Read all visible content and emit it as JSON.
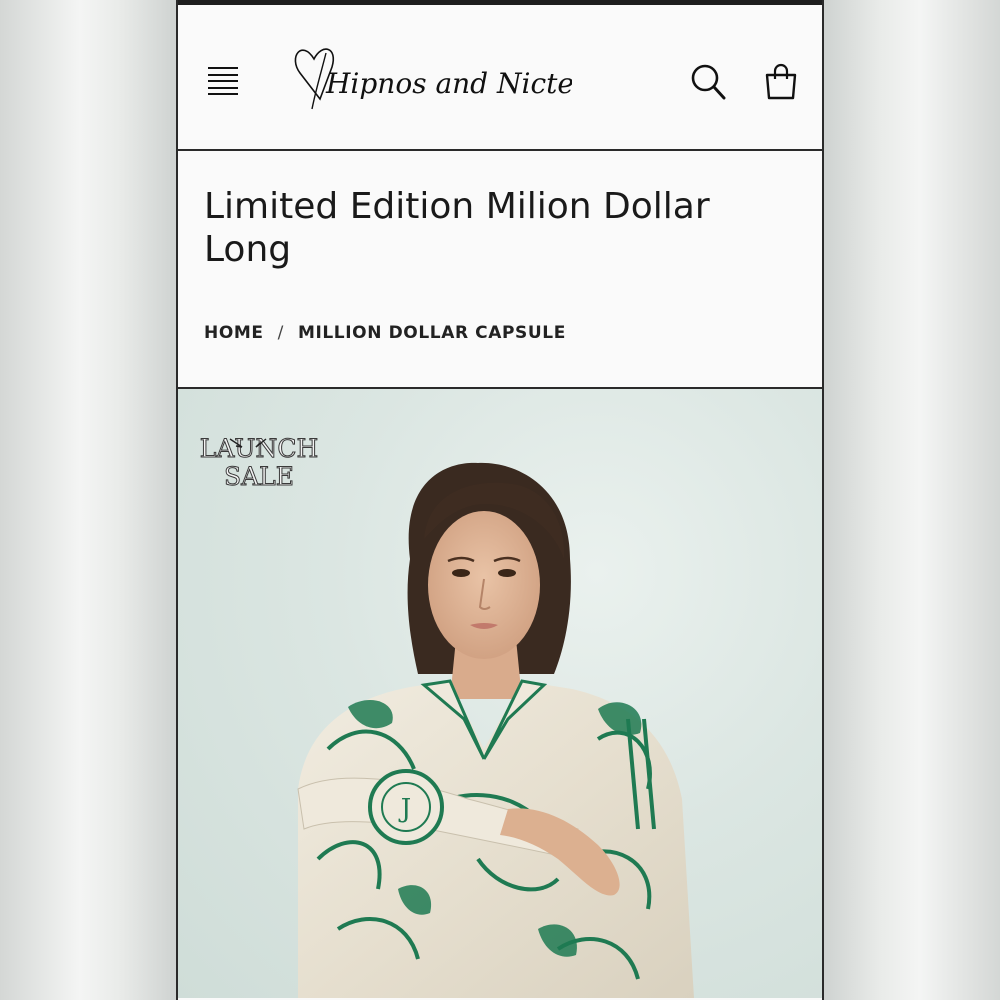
{
  "header": {
    "logo_text": "Hipnos and Nicte",
    "icons": {
      "menu": "hamburger-menu-icon",
      "search": "search-icon",
      "cart": "shopping-bag-icon"
    }
  },
  "product": {
    "title": "Limited Edition Milion Dollar Long"
  },
  "breadcrumb": {
    "items": [
      "HOME",
      "MILLION DOLLAR CAPSULE"
    ],
    "separator": "/"
  },
  "hero": {
    "badge_line1": "LAUNCH",
    "badge_line2": "SALE"
  },
  "colors": {
    "text": "#1a1a1a",
    "border": "#2a2a2a",
    "background": "#fafafa",
    "hero_bg": "#dbe6e2",
    "pattern_green": "#1f7a52"
  }
}
